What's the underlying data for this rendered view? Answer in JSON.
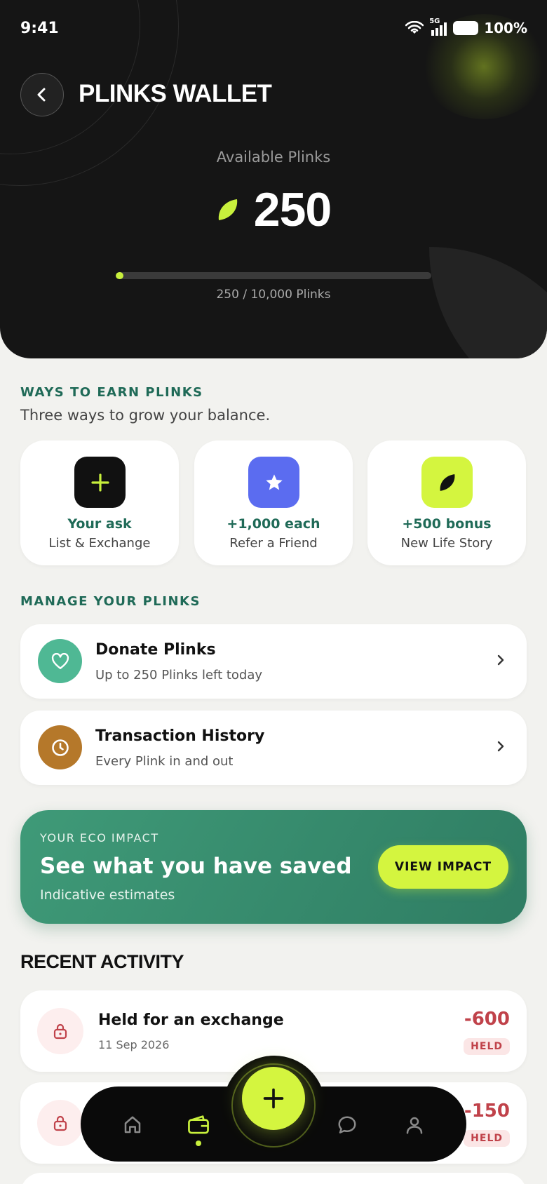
{
  "status_bar": {
    "time": "9:41",
    "network": "5G",
    "battery": "100%"
  },
  "header": {
    "title": "PLINKS WALLET",
    "available_label": "Available Plinks",
    "balance": "250",
    "progress_fraction": 0.025,
    "progress_text": "250 / 10,000 Plinks",
    "accent_color": "#c8f03c"
  },
  "earn": {
    "section_label": "WAYS TO EARN PLINKS",
    "subtitle": "Three ways to grow your balance.",
    "cards": [
      {
        "icon": "plus-icon",
        "value": "Your ask",
        "label": "List & Exchange",
        "icon_bg": "#111111"
      },
      {
        "icon": "star-icon",
        "value": "+1,000 each",
        "label": "Refer a Friend",
        "icon_bg": "#5b6cf0"
      },
      {
        "icon": "leaf-icon",
        "value": "+500 bonus",
        "label": "New Life Story",
        "icon_bg": "#d4f53f"
      }
    ]
  },
  "manage": {
    "section_label": "MANAGE YOUR PLINKS",
    "items": [
      {
        "icon": "heart-icon",
        "title": "Donate Plinks",
        "subtitle": "Up to 250 Plinks left today",
        "icon_bg": "#4fb894"
      },
      {
        "icon": "clock-icon",
        "title": "Transaction History",
        "subtitle": "Every Plink in and out",
        "icon_bg": "#b5782a"
      }
    ]
  },
  "impact": {
    "kicker": "YOUR ECO IMPACT",
    "headline": "See what you have saved",
    "subtitle": "Indicative estimates",
    "button_label": "VIEW IMPACT"
  },
  "activity": {
    "title": "RECENT ACTIVITY",
    "items": [
      {
        "icon": "lock-icon",
        "title": "Held for an exchange",
        "date": "11 Sep 2026",
        "amount": "-600",
        "badge": "HELD"
      },
      {
        "icon": "lock-icon",
        "title": "",
        "date": "",
        "amount": "-150",
        "badge": "HELD"
      }
    ]
  },
  "nav": {
    "items": [
      "home-icon",
      "wallet-icon",
      "plus-icon",
      "chat-icon",
      "profile-icon"
    ],
    "active": "wallet-icon"
  }
}
